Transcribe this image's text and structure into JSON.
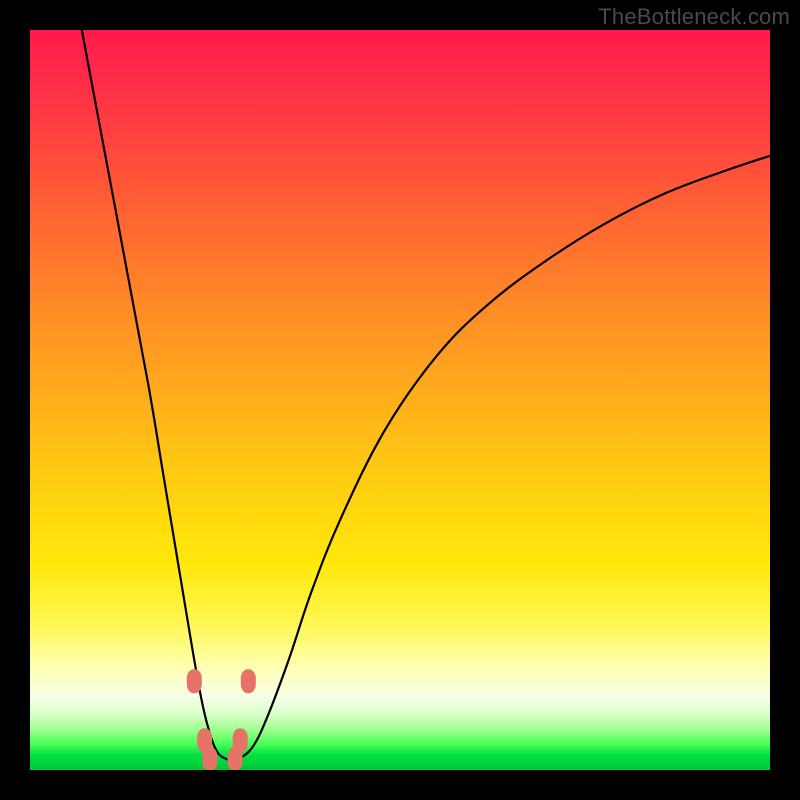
{
  "watermark": {
    "text": "TheBottleneck.com"
  },
  "colors": {
    "frame_bg": "#000000",
    "curve_stroke": "#000000",
    "marker_fill": "#e57368",
    "marker_stroke": "#c85a50"
  },
  "chart_data": {
    "type": "line",
    "title": "",
    "xlabel": "",
    "ylabel": "",
    "xlim": [
      0,
      100
    ],
    "ylim": [
      0,
      100
    ],
    "note": "Axes are unlabeled; values are estimated from pixel positions (0–100 percent of plot area). y increases upward; the curve's minimum touches the green band near the bottom.",
    "series": [
      {
        "name": "bottleneck-curve",
        "x": [
          7.0,
          10.0,
          13.0,
          16.0,
          18.0,
          20.0,
          22.0,
          23.5,
          25.0,
          26.5,
          28.0,
          30.0,
          32.0,
          35.0,
          38.0,
          42.0,
          48.0,
          55.0,
          62.0,
          70.0,
          78.0,
          86.0,
          94.0,
          100.0
        ],
        "y": [
          100.0,
          84.0,
          68.0,
          52.0,
          40.0,
          28.0,
          16.0,
          8.0,
          3.0,
          1.5,
          1.5,
          3.0,
          7.0,
          15.0,
          24.0,
          34.0,
          46.0,
          56.0,
          63.0,
          69.0,
          74.0,
          78.0,
          81.0,
          83.0
        ],
        "markers_x": [
          22.2,
          23.6,
          28.4,
          29.5,
          24.3,
          27.7
        ],
        "markers_y": [
          12.0,
          4.0,
          4.0,
          12.0,
          1.5,
          1.5
        ]
      }
    ]
  }
}
